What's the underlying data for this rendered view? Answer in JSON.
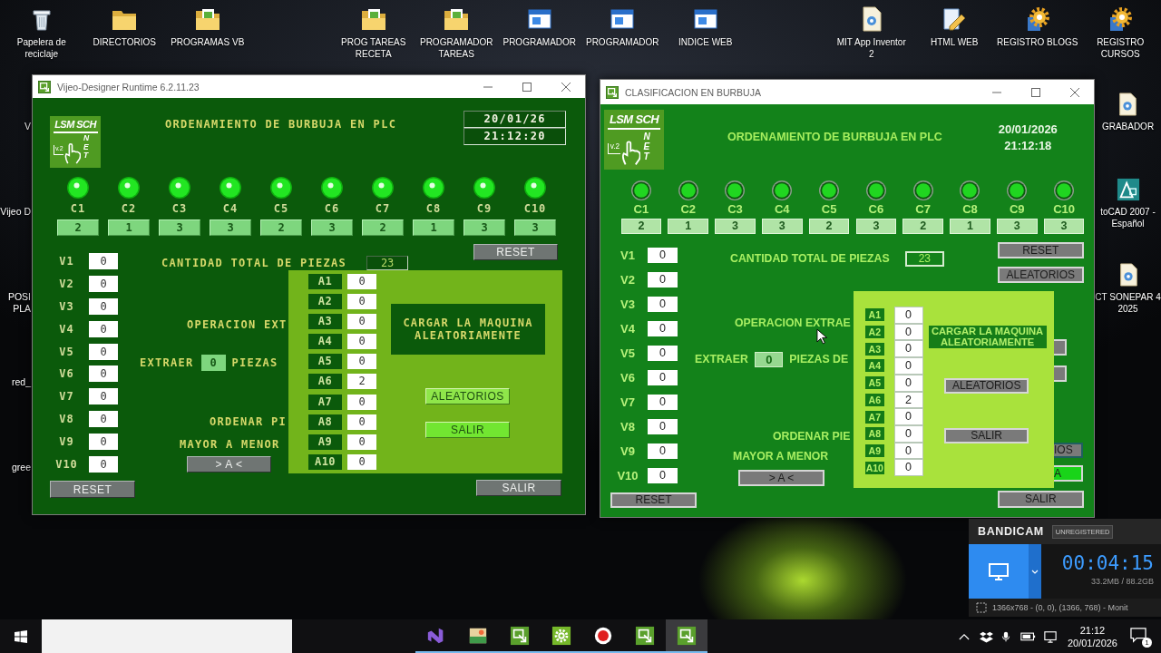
{
  "desktop": {
    "top_icons": [
      {
        "kind": "bin",
        "label": "Papelera de\nreciclaje"
      },
      {
        "kind": "folder",
        "label": "DIRECTORIOS"
      },
      {
        "kind": "folder-doc",
        "label": "PROGRAMAS VB"
      },
      {
        "kind": "folder-doc",
        "label": "PROG TAREAS\nRECETA"
      },
      {
        "kind": "folder-doc",
        "label": "PROGRAMADOR\nTAREAS"
      },
      {
        "kind": "window",
        "label": "PROGRAMADOR"
      },
      {
        "kind": "window",
        "label": "PROGRAMADOR"
      },
      {
        "kind": "window",
        "label": "INDICE WEB"
      },
      {
        "kind": "doc",
        "label": "MIT App Inventor\n2"
      },
      {
        "kind": "pencil",
        "label": "HTML WEB"
      },
      {
        "kind": "gear",
        "label": "REGISTRO BLOGS"
      },
      {
        "kind": "gear",
        "label": "REGISTRO\nCURSOS"
      }
    ],
    "left_shortcuts": [
      "V",
      "Vijeo D",
      "POSI\nPLA",
      "red_",
      "gree"
    ],
    "right_shortcuts": [
      {
        "kind": "doc",
        "label": "GRABADOR"
      },
      {
        "kind": "cad",
        "label": "toCAD 2007 -\nEspañol"
      },
      {
        "kind": "doc",
        "label": "CT SONEPAR 4\n2025"
      }
    ]
  },
  "windows": [
    {
      "kind": "vijeo",
      "title": "Vijeo-Designer Runtime 6.2.11.23",
      "logo": {
        "title": "LSM SCH",
        "version": "v.2",
        "mark": "NET"
      },
      "heading": "ORDENAMIENTO DE BURBUJA EN PLC",
      "date": "20/01/26",
      "time": "21:12:20",
      "conveyors": [
        {
          "label": "C1",
          "on": true,
          "value": "2"
        },
        {
          "label": "C2",
          "on": true,
          "value": "1"
        },
        {
          "label": "C3",
          "on": true,
          "value": "3"
        },
        {
          "label": "C4",
          "on": true,
          "value": "3"
        },
        {
          "label": "C5",
          "on": true,
          "value": "2"
        },
        {
          "label": "C6",
          "on": true,
          "value": "3"
        },
        {
          "label": "C7",
          "on": true,
          "value": "2"
        },
        {
          "label": "C8",
          "on": true,
          "value": "1"
        },
        {
          "label": "C9",
          "on": true,
          "value": "3"
        },
        {
          "label": "C10",
          "on": true,
          "value": "3"
        }
      ],
      "side_buttons": [
        "RESET"
      ],
      "counters": [
        {
          "label": "V1",
          "value": "0"
        },
        {
          "label": "V2",
          "value": "0"
        },
        {
          "label": "V3",
          "value": "0"
        },
        {
          "label": "V4",
          "value": "0"
        },
        {
          "label": "V5",
          "value": "0"
        },
        {
          "label": "V6",
          "value": "0"
        },
        {
          "label": "V7",
          "value": "0"
        },
        {
          "label": "V8",
          "value": "0"
        },
        {
          "label": "V9",
          "value": "0"
        },
        {
          "label": "V10",
          "value": "0"
        }
      ],
      "total_label": "CANTIDAD TOTAL DE PIEZAS",
      "total": "23",
      "operation_label": "OPERACION EXT",
      "extract_label": "EXTRAER",
      "extract_value": "0",
      "extract_suffix": "PIEZAS",
      "sort_label": "ORDENAR PI",
      "order_label": "MAYOR A MENOR",
      "sort_button": "> A <",
      "reset_button": "RESET",
      "exit_button": "SALIR",
      "popup": {
        "slots": [
          {
            "label": "A1",
            "value": "0"
          },
          {
            "label": "A2",
            "value": "0"
          },
          {
            "label": "A3",
            "value": "0"
          },
          {
            "label": "A4",
            "value": "0"
          },
          {
            "label": "A5",
            "value": "0"
          },
          {
            "label": "A6",
            "value": "2"
          },
          {
            "label": "A7",
            "value": "0"
          },
          {
            "label": "A8",
            "value": "0"
          },
          {
            "label": "A9",
            "value": "0"
          },
          {
            "label": "A10",
            "value": "0"
          }
        ],
        "message": "CARGAR LA MAQUINA\nALEATORIAMENTE",
        "buttons": [
          {
            "kind": "random",
            "label": "ALEATORIOS"
          },
          {
            "kind": "exit",
            "label": "SALIR"
          }
        ]
      }
    },
    {
      "kind": "winforms",
      "title": "CLASIFICACION EN BURBUJA",
      "logo": {
        "title": "LSM SCH",
        "version": "v.2",
        "mark": "NET"
      },
      "heading": "ORDENAMIENTO DE BURBUJA EN PLC",
      "date": "20/01/2026",
      "time": "21:12:18",
      "conveyors": [
        {
          "label": "C1",
          "on": true,
          "value": "2"
        },
        {
          "label": "C2",
          "on": true,
          "value": "1"
        },
        {
          "label": "C3",
          "on": true,
          "value": "3"
        },
        {
          "label": "C4",
          "on": true,
          "value": "3"
        },
        {
          "label": "C5",
          "on": true,
          "value": "2"
        },
        {
          "label": "C6",
          "on": true,
          "value": "3"
        },
        {
          "label": "C7",
          "on": true,
          "value": "2"
        },
        {
          "label": "C8",
          "on": true,
          "value": "1"
        },
        {
          "label": "C9",
          "on": true,
          "value": "3"
        },
        {
          "label": "C10",
          "on": true,
          "value": "3"
        }
      ],
      "side_buttons": [
        "RESET",
        "ALEATORIOS"
      ],
      "counters": [
        {
          "label": "V1",
          "value": "0"
        },
        {
          "label": "V2",
          "value": "0"
        },
        {
          "label": "V3",
          "value": "0"
        },
        {
          "label": "V4",
          "value": "0"
        },
        {
          "label": "V5",
          "value": "0"
        },
        {
          "label": "V6",
          "value": "0"
        },
        {
          "label": "V7",
          "value": "0"
        },
        {
          "label": "V8",
          "value": "0"
        },
        {
          "label": "V9",
          "value": "0"
        },
        {
          "label": "V10",
          "value": "0"
        }
      ],
      "total_label": "CANTIDAD TOTAL DE PIEZAS",
      "total": "23",
      "operation_label": "OPERACION EXTRAE",
      "extract_label": "EXTRAER",
      "extract_value": "0",
      "extract_suffix": "PIEZAS DE",
      "sort_label": "ORDENAR PIE",
      "order_label": "MAYOR A MENOR",
      "sort_button": "> A <",
      "reset_button": "RESET",
      "exit_button": "SALIR",
      "covered_buttons": [
        {
          "kind": "grey"
        },
        {
          "kind": "grey"
        },
        {
          "kind": "grey",
          "label": "IOS"
        },
        {
          "kind": "lit",
          "label": "A"
        }
      ],
      "popup": {
        "slots": [
          {
            "label": "A1",
            "value": "0"
          },
          {
            "label": "A2",
            "value": "0"
          },
          {
            "label": "A3",
            "value": "0"
          },
          {
            "label": "A4",
            "value": "0"
          },
          {
            "label": "A5",
            "value": "0"
          },
          {
            "label": "A6",
            "value": "2"
          },
          {
            "label": "A7",
            "value": "0"
          },
          {
            "label": "A8",
            "value": "0"
          },
          {
            "label": "A9",
            "value": "0"
          },
          {
            "label": "A10",
            "value": "0"
          }
        ],
        "message": "CARGAR LA MAQUINA\nALEATORIAMENTE",
        "buttons": [
          {
            "kind": "random",
            "label": "ALEATORIOS"
          },
          {
            "kind": "exit",
            "label": "SALIR"
          }
        ]
      }
    }
  ],
  "recorder": {
    "brand": "BANDICAM",
    "badge": "UNREGISTERED",
    "timer": "00:04:15",
    "storage": "33.2MB / 88.2GB",
    "region": "1366x768 - (0, 0), (1366, 768) - Monit"
  },
  "taskbar": {
    "apps": [
      {
        "kind": "ribbon",
        "selected": false
      },
      {
        "kind": "picture",
        "selected": false
      },
      {
        "kind": "hmi",
        "selected": false
      },
      {
        "kind": "gear",
        "selected": false
      },
      {
        "kind": "record",
        "selected": false
      },
      {
        "kind": "hmi",
        "selected": false
      },
      {
        "kind": "hmi",
        "selected": true
      }
    ],
    "time": "21:12",
    "date": "20/01/2026",
    "notifications": "1"
  }
}
